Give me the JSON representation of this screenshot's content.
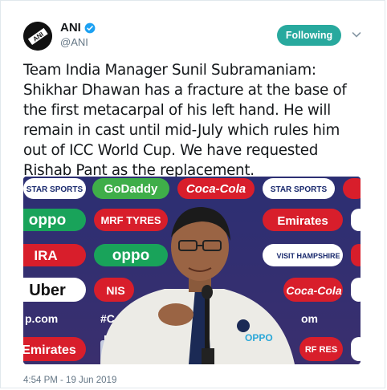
{
  "author": {
    "name": "ANI",
    "handle": "@ANI",
    "avatar_text": "ANI"
  },
  "follow_button": {
    "label": "Following"
  },
  "tweet": {
    "lines": [
      "Team India Manager Sunil Subramaniam:",
      "Shikhar Dhawan has a fracture at the base of",
      "the first metacarpal of his left hand. He will",
      "remain in cast until mid-July which rules him",
      "out of ICC World Cup. We have requested",
      "Rishab Pant as the replacement."
    ],
    "timestamp": "4:54 PM - 19 Jun 2019"
  },
  "media": {
    "sponsors": {
      "star_sports": "STAR SPORTS",
      "godaddy": "GoDaddy",
      "coca_cola": "Coca-Cola",
      "oppo": "oppo",
      "mrf": "MRF TYRES",
      "emirates": "Emirates",
      "ira": "IRA",
      "visit_hampshire": "VISIT HAMPSHIRE",
      "uber": "Uber",
      "nis": "NIS",
      "p_com": "p.com",
      "hash": "#C",
      "om": "om",
      "rf_res": "RF RES",
      "jersey_oppo": "OPPO"
    }
  },
  "colors": {
    "follow_bg": "#28a99e",
    "verified": "#1da1f2",
    "meta_text": "#657786"
  }
}
